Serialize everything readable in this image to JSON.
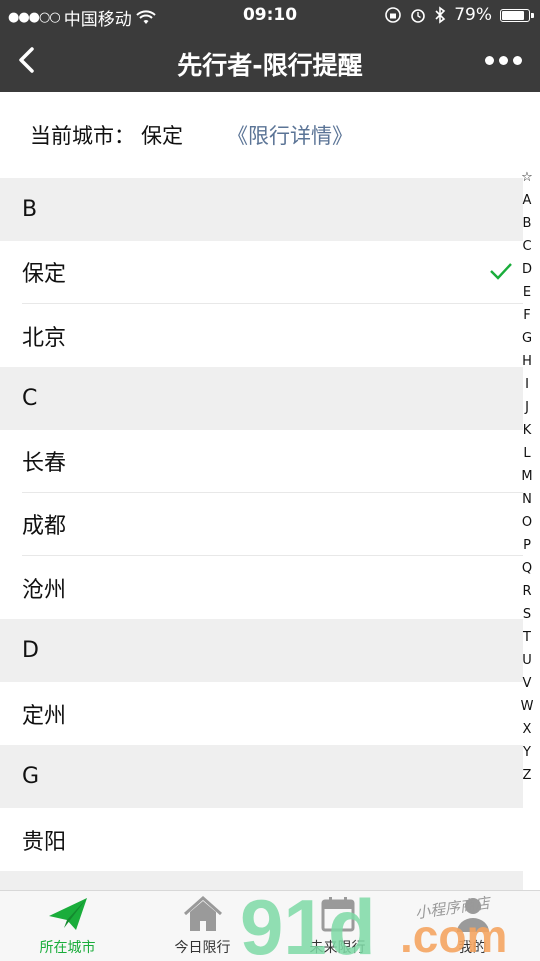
{
  "status": {
    "carrier": "中国移动",
    "time": "09:10",
    "battery": "79%",
    "battery_level": 0.79
  },
  "nav": {
    "title": "先行者-限行提醒"
  },
  "current": {
    "label": "当前城市：",
    "city": "保定",
    "link": "《限行详情》"
  },
  "sections": [
    {
      "letter": "B",
      "cities": [
        "保定",
        "北京"
      ]
    },
    {
      "letter": "C",
      "cities": [
        "长春",
        "成都",
        "沧州"
      ]
    },
    {
      "letter": "D",
      "cities": [
        "定州"
      ]
    },
    {
      "letter": "G",
      "cities": [
        "贵阳"
      ]
    }
  ],
  "index_letters": [
    "☆",
    "A",
    "B",
    "C",
    "D",
    "E",
    "F",
    "G",
    "H",
    "I",
    "J",
    "K",
    "L",
    "M",
    "N",
    "O",
    "P",
    "Q",
    "R",
    "S",
    "T",
    "U",
    "V",
    "W",
    "X",
    "Y",
    "Z"
  ],
  "tabs": [
    {
      "label": "所在城市",
      "icon": "paper-plane-icon",
      "active": true
    },
    {
      "label": "今日限行",
      "icon": "home-icon",
      "active": false
    },
    {
      "label": "未来限行",
      "icon": "calendar-icon",
      "active": false
    },
    {
      "label": "我的",
      "icon": "person-icon",
      "active": false
    }
  ],
  "watermark": {
    "brand": "91",
    "domain": ".com",
    "caption": "小程序商店"
  },
  "colors": {
    "accent": "#1aad3b",
    "link": "#5b7496",
    "navbar": "#3b3b3b"
  }
}
